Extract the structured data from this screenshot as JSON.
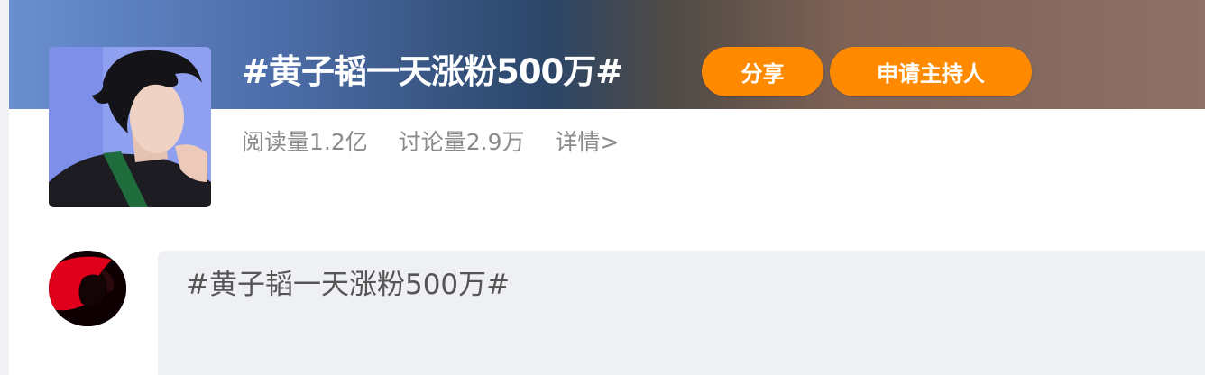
{
  "topic": {
    "title": "#黄子韬一天涨粉500万#",
    "share_label": "分享",
    "host_label": "申请主持人",
    "read_count": "阅读量1.2亿",
    "discuss_count": "讨论量2.9万",
    "details_link": "详情>"
  },
  "composer": {
    "text": "#黄子韬一天涨粉500万#"
  },
  "colors": {
    "accent_button": "#ff8a00",
    "banner_left": "#6a8fd0",
    "banner_right": "#8d7066",
    "composer_bg": "#eef0f4"
  }
}
